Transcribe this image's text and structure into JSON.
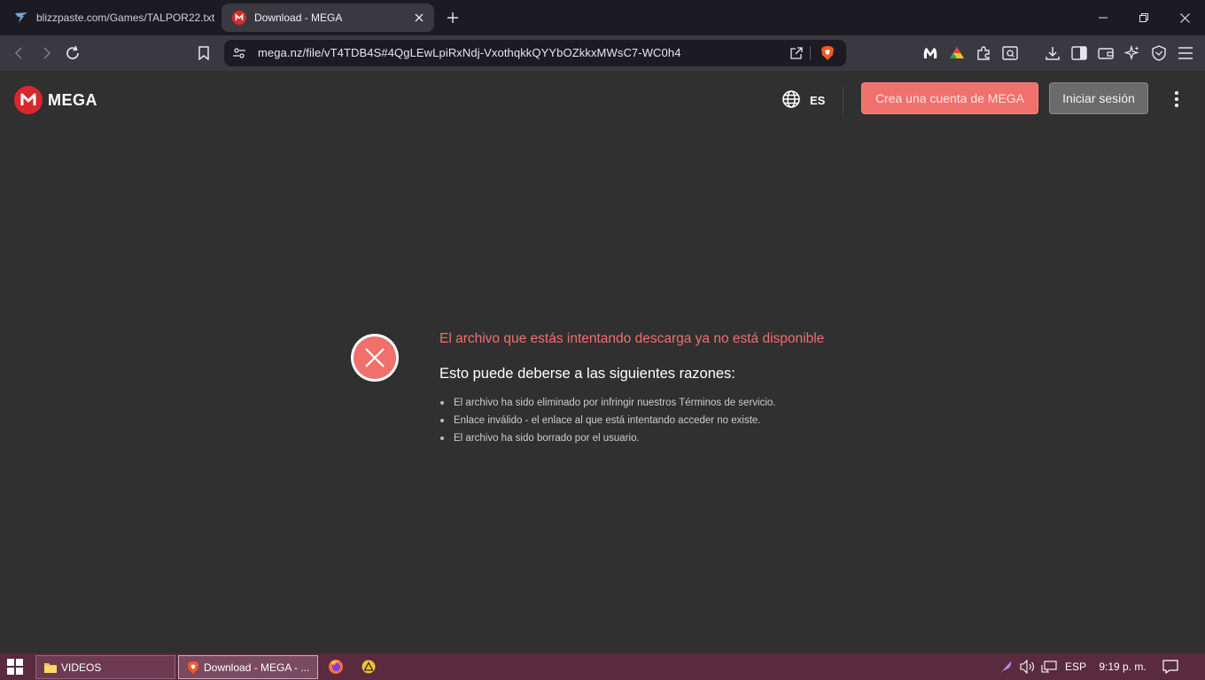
{
  "browser": {
    "tabs": [
      {
        "title": "blizzpaste.com/Games/TALPOR22.txt",
        "active": false
      },
      {
        "title": "Download - MEGA",
        "active": true
      }
    ],
    "url": "mega.nz/file/vT4TDB4S#4QgLEwLpiRxNdj-VxothqkkQYYbOZkkxMWsC7-WC0h4"
  },
  "header": {
    "logo_text": "MEGA",
    "language": "ES",
    "create_account": "Crea una cuenta de MEGA",
    "login": "Iniciar sesión"
  },
  "error": {
    "title": "El archivo que estás intentando descarga ya no está disponible",
    "subtitle": "Esto puede deberse a las siguientes razones:",
    "reasons": [
      "El archivo ha sido eliminado por infringir nuestros Términos de servicio.",
      "Enlace inválido - el enlace al que está intentando acceder no existe.",
      "El archivo ha sido borrado por el usuario."
    ]
  },
  "taskbar": {
    "items": [
      {
        "label": "VIDEOS"
      },
      {
        "label": "Download - MEGA - ..."
      }
    ],
    "language": "ESP",
    "time": "9:19 p. m."
  },
  "colors": {
    "accent": "#f0706c",
    "brand_red": "#d9272e",
    "page_bg": "#303030"
  }
}
